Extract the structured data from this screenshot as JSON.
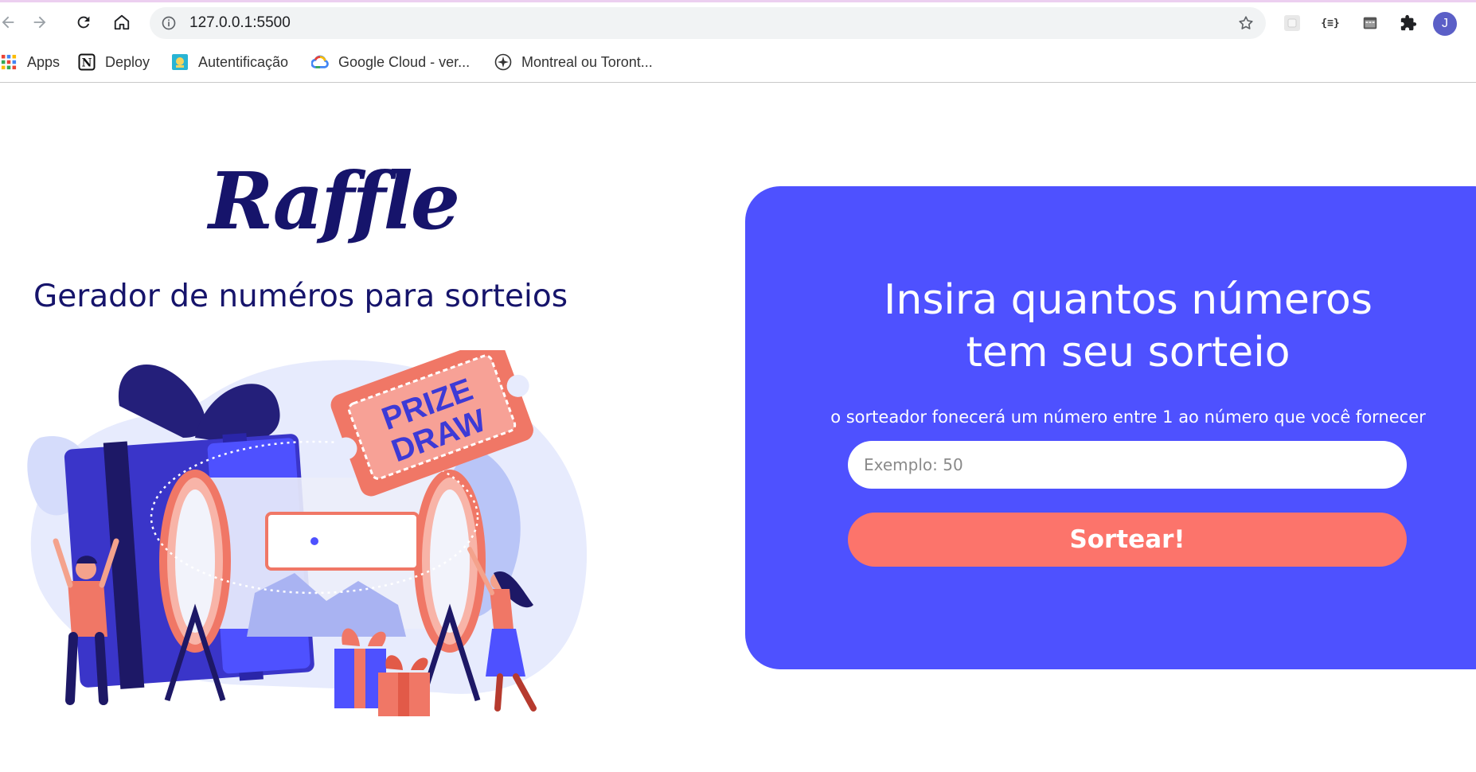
{
  "browser": {
    "url": "127.0.0.1:5500",
    "profile_initial": "J",
    "extension_json_label": "{≡}",
    "bookmarks": [
      {
        "label": "Apps",
        "icon": "apps-grid-icon"
      },
      {
        "label": "Deploy",
        "icon": "notion-icon"
      },
      {
        "label": "Autentificação",
        "icon": "auth-icon"
      },
      {
        "label": "Google Cloud - ver...",
        "icon": "google-cloud-icon"
      },
      {
        "label": "Montreal ou Toront...",
        "icon": "compass-icon"
      }
    ]
  },
  "page": {
    "logo": "Raffle",
    "subtitle": "Gerador de numéros para sorteios",
    "illustration": {
      "ticket_text_line1": "PRIZE",
      "ticket_text_line2": "DRAW"
    },
    "card": {
      "title_line1": "Insira quantos números",
      "title_line2": "tem seu sorteio",
      "description": "o sorteador fonecerá um número entre 1 ao número que você fornecer",
      "input_placeholder": "Exemplo: 50",
      "button_label": "Sortear!"
    }
  },
  "colors": {
    "brand_navy": "#16146b",
    "card_background": "#4e51ff",
    "button_coral": "#fc746b"
  }
}
